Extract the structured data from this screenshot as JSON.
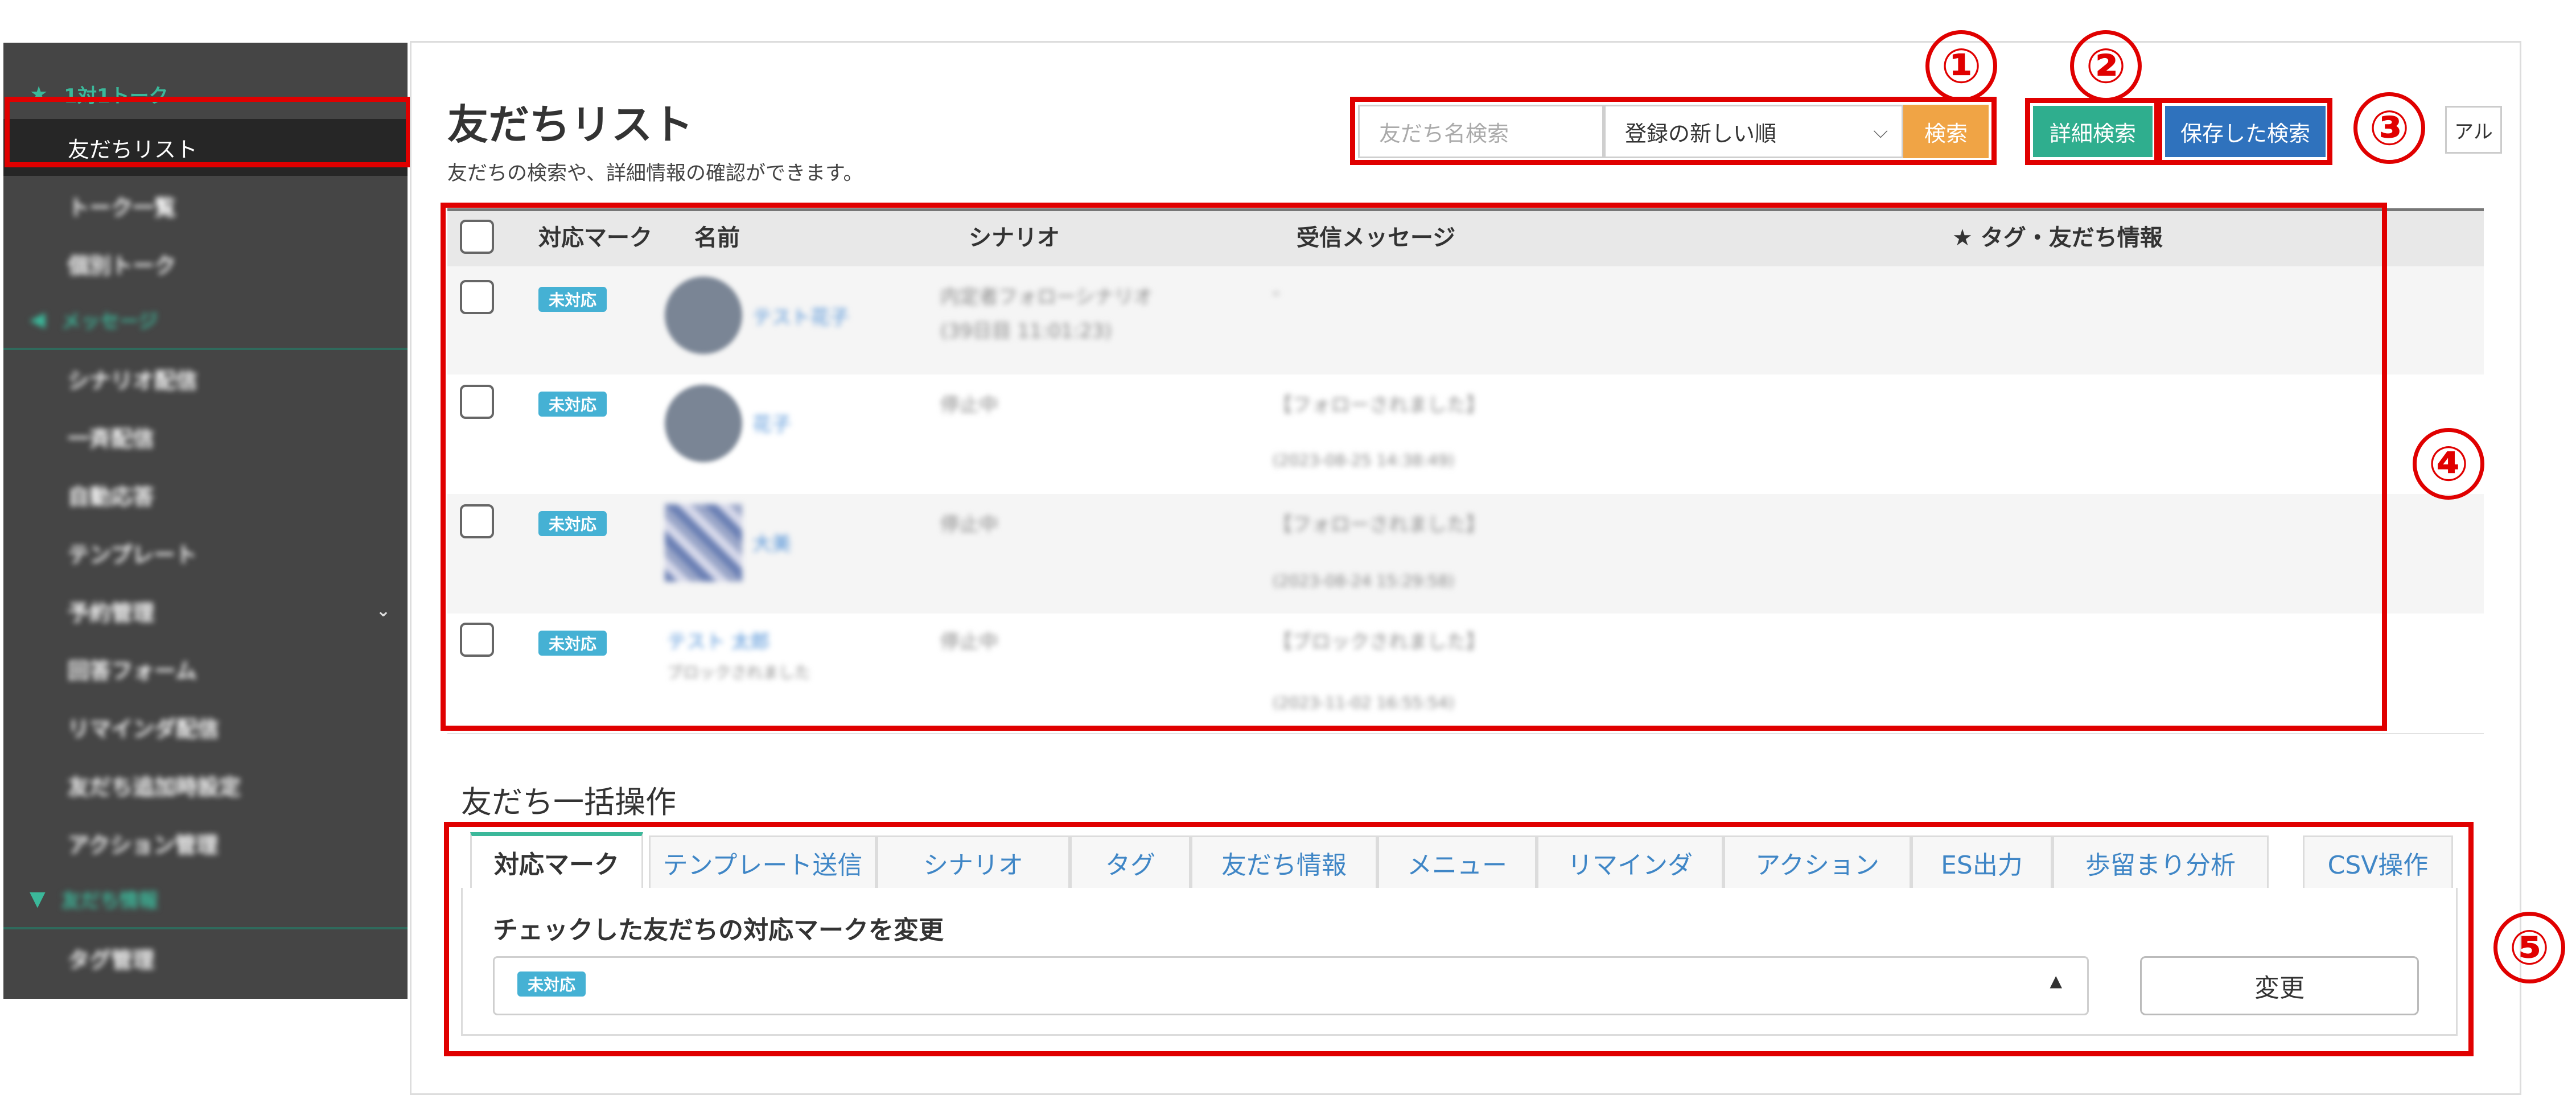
{
  "sidebar": {
    "section_talk": "1対1トーク",
    "active_item": "友だちリスト",
    "items_blurred": [
      "トーク一覧",
      "個別トーク"
    ],
    "section_message": "メッセージ",
    "message_items_blurred": [
      "シナリオ配信",
      "一斉配信",
      "自動応答",
      "テンプレート",
      "予約管理",
      "回答フォーム",
      "リマインダ配信",
      "友だち追加時設定",
      "アクション管理"
    ],
    "section_friends": "友だち情報",
    "friends_items_blurred": [
      "タグ管理"
    ]
  },
  "header": {
    "title": "友だちリスト",
    "description": "友だちの検索や、詳細情報の確認ができます。"
  },
  "search": {
    "name_placeholder": "友だち名検索",
    "sort_selected": "登録の新しい順",
    "search_button": "検索",
    "detail_search_button": "詳細検索",
    "saved_search_button": "保存した検索",
    "manual_button": "アル"
  },
  "annotations": [
    "①",
    "②",
    "③",
    "④",
    "⑤"
  ],
  "table": {
    "columns": [
      "対応マーク",
      "名前",
      "シナリオ",
      "受信メッセージ",
      "★ タグ・友だち情報"
    ],
    "rows": [
      {
        "status": "未対応",
        "name": "テスト花子",
        "scenario": "内定者フォローシナリオ",
        "scenario_sub": "(39日目 11:01:23)",
        "message": "-",
        "message_time": ""
      },
      {
        "status": "未対応",
        "name": "花子",
        "scenario": "停止中",
        "scenario_sub": "",
        "message": "【フォローされました】",
        "message_time": "(2023-08-25 14:38:49)"
      },
      {
        "status": "未対応",
        "name": "大美",
        "scenario": "停止中",
        "scenario_sub": "",
        "message": "【フォローされました】",
        "message_time": "(2023-08-24 15:29:58)"
      },
      {
        "status": "未対応",
        "name": "テスト 太郎",
        "name_sub": "ブロックされました",
        "scenario": "停止中",
        "scenario_sub": "",
        "message": "【ブロックされました】",
        "message_time": "(2023-11-02 16:55:54)"
      }
    ]
  },
  "bulk": {
    "title": "友だち一括操作",
    "tabs": [
      "対応マーク",
      "テンプレート送信",
      "シナリオ",
      "タグ",
      "友だち情報",
      "メニュー",
      "リマインダ",
      "アクション",
      "ES出力",
      "歩留まり分析",
      "CSV操作"
    ],
    "panel_label": "チェックした友だちの対応マークを変更",
    "selected_mark": "未対応",
    "change_button": "変更"
  },
  "colors": {
    "sidebar_bg": "#454545",
    "accent_green": "#3bb89a",
    "search_orange": "#f0a445",
    "detail_green": "#2fae8e",
    "saved_blue": "#2f72bd",
    "badge_blue": "#45b1d4",
    "annotation_red": "#e00000"
  }
}
